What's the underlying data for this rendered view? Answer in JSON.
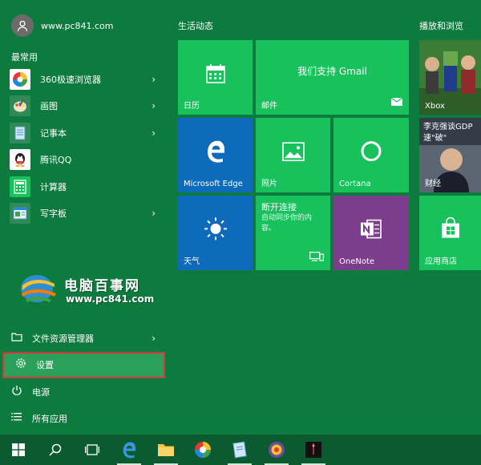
{
  "user": {
    "name": "www.pc841.com"
  },
  "most_used_label": "最常用",
  "apps": [
    {
      "label": "360极速浏览器",
      "chevron": true
    },
    {
      "label": "画图",
      "chevron": true
    },
    {
      "label": "记事本",
      "chevron": true
    },
    {
      "label": "腾讯QQ",
      "chevron": false
    },
    {
      "label": "计算器",
      "chevron": false
    },
    {
      "label": "写字板",
      "chevron": true
    }
  ],
  "watermark": {
    "title": "电脑百事网",
    "url": "www.pc841.com"
  },
  "bottom": {
    "file_explorer": "文件资源管理器",
    "settings": "设置",
    "power": "电源",
    "all_apps": "所有应用"
  },
  "groups": {
    "life": "生活动态",
    "play": "播放和浏览"
  },
  "tiles": {
    "calendar": "日历",
    "mail": "邮件",
    "mail_tagline": "我们支持 Gmail",
    "edge": "Microsoft Edge",
    "photos": "照片",
    "cortana": "Cortana",
    "weather": "天气",
    "disconnected_title": "断开连接",
    "disconnected_body": "自动同步你的内容。",
    "onenote": "OneNote",
    "xbox": "Xbox",
    "news": "财经",
    "news_headline": "李克强谈GDP 速\"破\"",
    "store": "应用商店"
  },
  "colors": {
    "background": "#0d7a3e",
    "tile_green": "#17c15c",
    "tile_blue": "#0e6abb",
    "tile_purple": "#7c3e8c",
    "highlight_border": "#d6373b"
  }
}
